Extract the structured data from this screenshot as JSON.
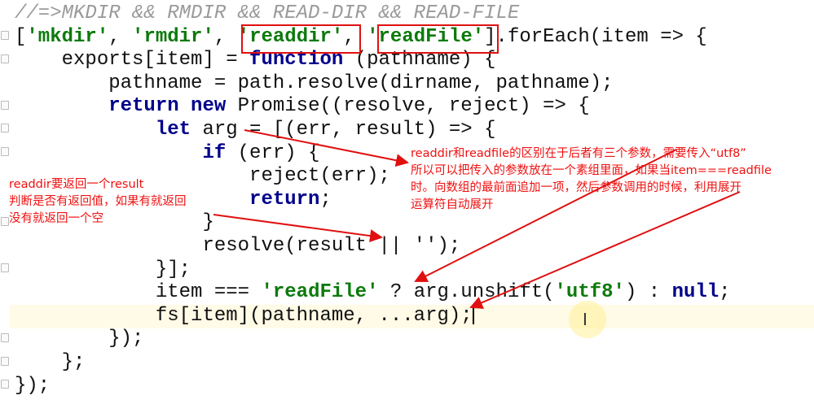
{
  "code_lines": [
    [
      [
        "cm",
        "//=>MKDIR && RMDIR && READ-DIR && READ-FILE"
      ]
    ],
    [
      [
        "pl",
        "["
      ],
      [
        "st",
        "'mkdir'"
      ],
      [
        "pl",
        ", "
      ],
      [
        "st",
        "'rmdir'"
      ],
      [
        "pl",
        ", "
      ],
      [
        "st",
        "'readdir'"
      ],
      [
        "pl",
        ", "
      ],
      [
        "st",
        "'readFile'"
      ],
      [
        "pl",
        "].forEach(item => {"
      ]
    ],
    [
      [
        "pl",
        "    exports[item] = "
      ],
      [
        "kw",
        "function"
      ],
      [
        "pl",
        " (pathname) {"
      ]
    ],
    [
      [
        "pl",
        "        pathname = path.resolve(dirname, pathname);"
      ]
    ],
    [
      [
        "kw",
        "        return new"
      ],
      [
        "pl",
        " Promise((resolve, reject) => {"
      ]
    ],
    [
      [
        "kw",
        "            let"
      ],
      [
        "pl",
        " arg = [(err, result) => {"
      ]
    ],
    [
      [
        "kw",
        "                if"
      ],
      [
        "pl",
        " (err) {"
      ]
    ],
    [
      [
        "pl",
        "                    reject(err);"
      ]
    ],
    [
      [
        "kw",
        "                    return"
      ],
      [
        "pl",
        ";"
      ]
    ],
    [
      [
        "pl",
        "                }"
      ]
    ],
    [
      [
        "pl",
        "                resolve(result || '');"
      ]
    ],
    [
      [
        "pl",
        "            }];"
      ]
    ],
    [
      [
        "pl",
        "            item === "
      ],
      [
        "st",
        "'readFile'"
      ],
      [
        "pl",
        " ? arg.unshift("
      ],
      [
        "st",
        "'utf8'"
      ],
      [
        "pl",
        ") : "
      ],
      [
        "kw",
        "null"
      ],
      [
        "pl",
        ";"
      ]
    ],
    [
      [
        "pl",
        "            fs[item](pathname, ...arg);"
      ]
    ],
    [
      [
        "pl",
        "        });"
      ]
    ],
    [
      [
        "pl",
        "    };"
      ]
    ],
    [
      [
        "pl",
        "});"
      ]
    ]
  ],
  "annotations": {
    "right_note": "readdir和readfile的区别在于后者有三个参数，需要传入“utf8”\n所以可以把传入的参数放在一个素组里面，如果当item===readfile\n时。向数组的最前面追加一项，然后参数调用的时候，利用展开\n运算符自动展开",
    "left_note": "readdir要返回一个result\n判断是否有返回值，如果有就返回\n没有就返回一个空"
  },
  "colors": {
    "annotation": "#e01010",
    "string": "#0c7a0c",
    "keyword": "#00008b",
    "comment": "#9a9a9a",
    "current_line": "#fffbe6"
  }
}
